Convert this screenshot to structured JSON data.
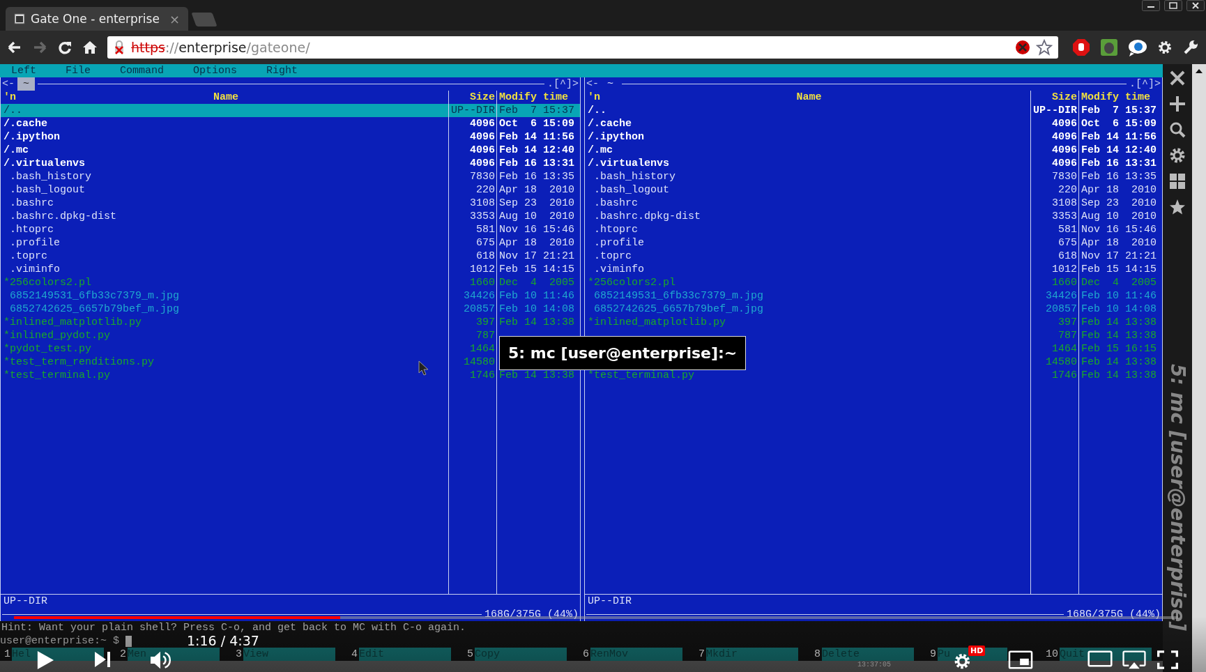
{
  "browser": {
    "tab": {
      "title": "Gate One - enterprise",
      "close": "×"
    },
    "url": {
      "scheme": "https",
      "separator": "://",
      "host": "enterprise",
      "path": "/gateone/"
    }
  },
  "menu": [
    "Left",
    "File",
    "Command",
    "Options",
    "Right"
  ],
  "panels": [
    {
      "top_left": "<-",
      "path": "~",
      "path_active": true,
      "top_right": ".[^]>",
      "columns": [
        "'n",
        "Name",
        "Size",
        "Modify time"
      ],
      "rows": [
        {
          "name": "/..",
          "size": "UP--DIR",
          "time": "Feb  7 15:37",
          "kind": "updir",
          "selected": true
        },
        {
          "name": "/.cache",
          "size": "4096",
          "time": "Oct  6 15:09",
          "kind": "dir",
          "selected": false
        },
        {
          "name": "/.ipython",
          "size": "4096",
          "time": "Feb 14 11:56",
          "kind": "dir",
          "selected": false
        },
        {
          "name": "/.mc",
          "size": "4096",
          "time": "Feb 14 12:40",
          "kind": "dir",
          "selected": false
        },
        {
          "name": "/.virtualenvs",
          "size": "4096",
          "time": "Feb 16 13:31",
          "kind": "dir",
          "selected": false
        },
        {
          "name": " .bash_history",
          "size": "7830",
          "time": "Feb 16 13:35",
          "kind": "file",
          "selected": false
        },
        {
          "name": " .bash_logout",
          "size": "220",
          "time": "Apr 18  2010",
          "kind": "file",
          "selected": false
        },
        {
          "name": " .bashrc",
          "size": "3108",
          "time": "Sep 23  2010",
          "kind": "file",
          "selected": false
        },
        {
          "name": " .bashrc.dpkg-dist",
          "size": "3353",
          "time": "Aug 10  2010",
          "kind": "file",
          "selected": false
        },
        {
          "name": " .htoprc",
          "size": "581",
          "time": "Nov 16 15:46",
          "kind": "file",
          "selected": false
        },
        {
          "name": " .profile",
          "size": "675",
          "time": "Apr 18  2010",
          "kind": "file",
          "selected": false
        },
        {
          "name": " .toprc",
          "size": "618",
          "time": "Nov 17 21:21",
          "kind": "file",
          "selected": false
        },
        {
          "name": " .viminfo",
          "size": "1012",
          "time": "Feb 15 14:15",
          "kind": "file",
          "selected": false
        },
        {
          "name": "*256colors2.pl",
          "size": "1660",
          "time": "Dec  4  2005",
          "kind": "exec",
          "selected": false
        },
        {
          "name": " 6852149531_6fb33c7379_m.jpg",
          "size": "34426",
          "time": "Feb 10 11:46",
          "kind": "image",
          "selected": false
        },
        {
          "name": " 6852742625_6657b79bef_m.jpg",
          "size": "20857",
          "time": "Feb 10 14:08",
          "kind": "image",
          "selected": false
        },
        {
          "name": "*inlined_matplotlib.py",
          "size": "397",
          "time": "Feb 14 13:38",
          "kind": "exec",
          "selected": false
        },
        {
          "name": "*inlined_pydot.py",
          "size": "787",
          "kind": "exec",
          "selected": false
        },
        {
          "name": "*pydot_test.py",
          "size": "1464",
          "kind": "exec",
          "selected": false
        },
        {
          "name": "*test_term_renditions.py",
          "size": "14580",
          "kind": "exec",
          "selected": false
        },
        {
          "name": "*test_terminal.py",
          "size": "1746",
          "time": "Feb 14 13:38",
          "kind": "exec",
          "selected": false
        }
      ],
      "status": "UP--DIR",
      "disk": "168G/375G (44%)"
    },
    {
      "top_left": "<-",
      "path": "~",
      "path_active": false,
      "top_right": ".[^]>",
      "columns": [
        "'n",
        "Name",
        "Size",
        "Modify time"
      ],
      "rows": [
        {
          "name": "/..",
          "size": "UP--DIR",
          "time": "Feb  7 15:37",
          "kind": "updir",
          "selected": false
        },
        {
          "name": "/.cache",
          "size": "4096",
          "time": "Oct  6 15:09",
          "kind": "dir",
          "selected": false
        },
        {
          "name": "/.ipython",
          "size": "4096",
          "time": "Feb 14 11:56",
          "kind": "dir",
          "selected": false
        },
        {
          "name": "/.mc",
          "size": "4096",
          "time": "Feb 14 12:40",
          "kind": "dir",
          "selected": false
        },
        {
          "name": "/.virtualenvs",
          "size": "4096",
          "time": "Feb 16 13:31",
          "kind": "dir",
          "selected": false
        },
        {
          "name": " .bash_history",
          "size": "7830",
          "time": "Feb 16 13:35",
          "kind": "file",
          "selected": false
        },
        {
          "name": " .bash_logout",
          "size": "220",
          "time": "Apr 18  2010",
          "kind": "file",
          "selected": false
        },
        {
          "name": " .bashrc",
          "size": "3108",
          "time": "Sep 23  2010",
          "kind": "file",
          "selected": false
        },
        {
          "name": " .bashrc.dpkg-dist",
          "size": "3353",
          "time": "Aug 10  2010",
          "kind": "file",
          "selected": false
        },
        {
          "name": " .htoprc",
          "size": "581",
          "time": "Nov 16 15:46",
          "kind": "file",
          "selected": false
        },
        {
          "name": " .profile",
          "size": "675",
          "time": "Apr 18  2010",
          "kind": "file",
          "selected": false
        },
        {
          "name": " .toprc",
          "size": "618",
          "time": "Nov 17 21:21",
          "kind": "file",
          "selected": false
        },
        {
          "name": " .viminfo",
          "size": "1012",
          "time": "Feb 15 14:15",
          "kind": "file",
          "selected": false
        },
        {
          "name": "*256colors2.pl",
          "size": "1660",
          "time": "Dec  4  2005",
          "kind": "exec",
          "selected": false
        },
        {
          "name": " 6852149531_6fb33c7379_m.jpg",
          "size": "34426",
          "time": "Feb 10 11:46",
          "kind": "image",
          "selected": false
        },
        {
          "name": " 6852742625_6657b79bef_m.jpg",
          "size": "20857",
          "time": "Feb 10 14:08",
          "kind": "image",
          "selected": false
        },
        {
          "name": "*inlined_matplotlib.py",
          "size": "397",
          "time": "Feb 14 13:38",
          "kind": "exec",
          "selected": false
        },
        {
          "size": "787",
          "time": "Feb 14 13:38",
          "kind": "exec",
          "selected": false
        },
        {
          "size": "1464",
          "time": "Feb 15 16:15",
          "kind": "exec",
          "selected": false
        },
        {
          "size": "14580",
          "time": "Feb 14 13:38",
          "kind": "exec",
          "selected": false
        },
        {
          "name": "*test_terminal.py",
          "size": "1746",
          "time": "Feb 14 13:38",
          "kind": "exec",
          "selected": false
        }
      ],
      "status": "UP--DIR",
      "disk": "168G/375G (44%)"
    }
  ],
  "hint": "Hint: Want your plain shell? Press C-o, and get back to MC with C-o again.",
  "prompt": "user@enterprise:~ $",
  "function_keys": [
    {
      "key": "1",
      "label": "Hel"
    },
    {
      "key": "2",
      "label": "Men"
    },
    {
      "key": "3",
      "label": "View"
    },
    {
      "key": "4",
      "label": "Edit"
    },
    {
      "key": "5",
      "label": "Copy"
    },
    {
      "key": "6",
      "label": "RenMov"
    },
    {
      "key": "7",
      "label": "Mkdir"
    },
    {
      "key": "8",
      "label": "Delete"
    },
    {
      "key": "9",
      "label": "Pu"
    },
    {
      "key": "10",
      "label": "Quit"
    }
  ],
  "clock": "13:37:05",
  "tooltip": "5: mc [user@enterprise]:~",
  "sidebar_title": "5: mc [user@enterprise]",
  "video": {
    "level": 0.28,
    "time": "1:16 / 4:37",
    "badge": "HD"
  }
}
